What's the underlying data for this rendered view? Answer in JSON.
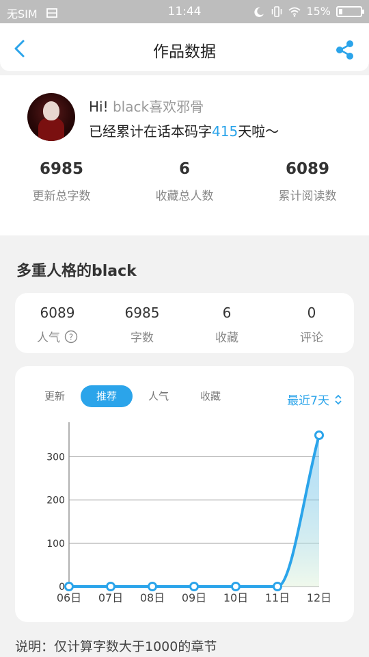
{
  "statusbar": {
    "carrier": "无SIM",
    "time": "11:44",
    "battery_text": "15%",
    "battery_level": 0.15
  },
  "header": {
    "title": "作品数据"
  },
  "profile": {
    "greeting_hi": "Hi!",
    "name": "black喜欢邪骨",
    "days_prefix": "已经累计在话本码字",
    "days_count": "415",
    "days_suffix": "天啦～",
    "stats": [
      {
        "value": "6985",
        "label": "更新总字数"
      },
      {
        "value": "6",
        "label": "收藏总人数"
      },
      {
        "value": "6089",
        "label": "累计阅读数"
      }
    ]
  },
  "work": {
    "title": "多重人格的black",
    "stats": [
      {
        "value": "6089",
        "label": "人气"
      },
      {
        "value": "6985",
        "label": "字数"
      },
      {
        "value": "6",
        "label": "收藏"
      },
      {
        "value": "0",
        "label": "评论"
      }
    ]
  },
  "chart": {
    "tabs": [
      "更新",
      "推荐",
      "人气",
      "收藏"
    ],
    "active_tab": 1,
    "period": "最近7天",
    "accent": "#2ba4ea"
  },
  "chart_data": {
    "type": "line",
    "categories": [
      "06日",
      "07日",
      "08日",
      "09日",
      "10日",
      "11日",
      "12日"
    ],
    "values": [
      0,
      0,
      0,
      0,
      0,
      0,
      350
    ],
    "yticks": [
      0,
      100,
      200,
      300
    ],
    "ylim": [
      0,
      380
    ],
    "grid": true
  },
  "note": "说明：仅计算字数大于1000的章节"
}
